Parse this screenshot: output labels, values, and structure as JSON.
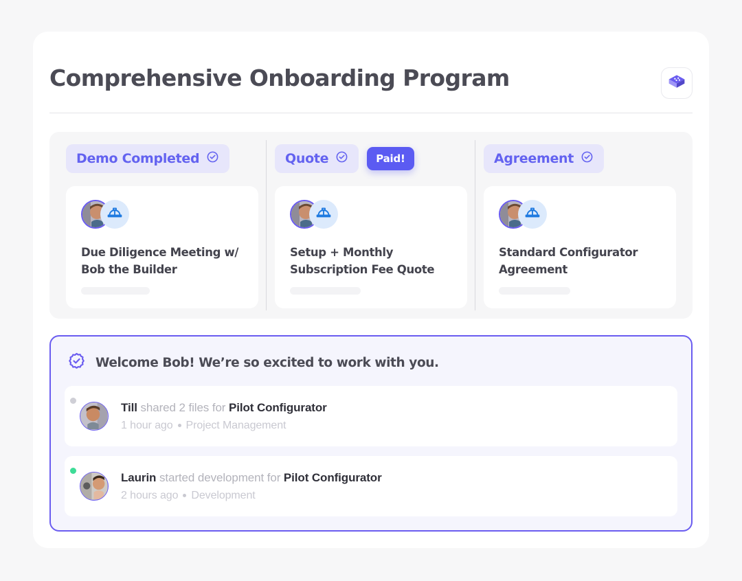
{
  "header": {
    "title": "Comprehensive Onboarding Program",
    "brand_icon": "isometric-cube-icon"
  },
  "colors": {
    "accent": "#6a5cf0",
    "accent_solid": "#5b5bf2",
    "pill_bg": "#e7e6fb",
    "pill_text": "#6362f0",
    "panel_bg": "#f5f5fd",
    "page_bg": "#f7f7f8",
    "helmet_blue": "#1f7ae0",
    "status_online": "#3ddc97",
    "status_offline": "#cfcfd6"
  },
  "stages": [
    {
      "label": "Demo Completed",
      "check_icon": "check-circle-icon",
      "badge": null,
      "card": {
        "avatar": "avatar-photo",
        "role_icon": "hard-hat-icon",
        "title": "Due Diligence Meeting w/ Bob the Builder"
      }
    },
    {
      "label": "Quote",
      "check_icon": "check-circle-icon",
      "badge": "Paid!",
      "card": {
        "avatar": "avatar-photo",
        "role_icon": "hard-hat-icon",
        "title": "Setup + Monthly Subscription Fee Quote"
      }
    },
    {
      "label": "Agreement",
      "check_icon": "check-circle-icon",
      "badge": null,
      "card": {
        "avatar": "avatar-photo",
        "role_icon": "hard-hat-icon",
        "title": "Standard Configurator Agreement"
      }
    }
  ],
  "welcome": {
    "icon": "verified-badge-icon",
    "message": "Welcome Bob! We’re so excited to work with you."
  },
  "activities": [
    {
      "status": "offline",
      "actor": "Till",
      "action": "shared 2 files for",
      "target": "Pilot Configurator",
      "time": "1 hour ago",
      "category": "Project Management"
    },
    {
      "status": "online",
      "actor": "Laurin",
      "action": "started development for",
      "target": "Pilot Configurator",
      "time": "2 hours ago",
      "category": "Development"
    }
  ]
}
